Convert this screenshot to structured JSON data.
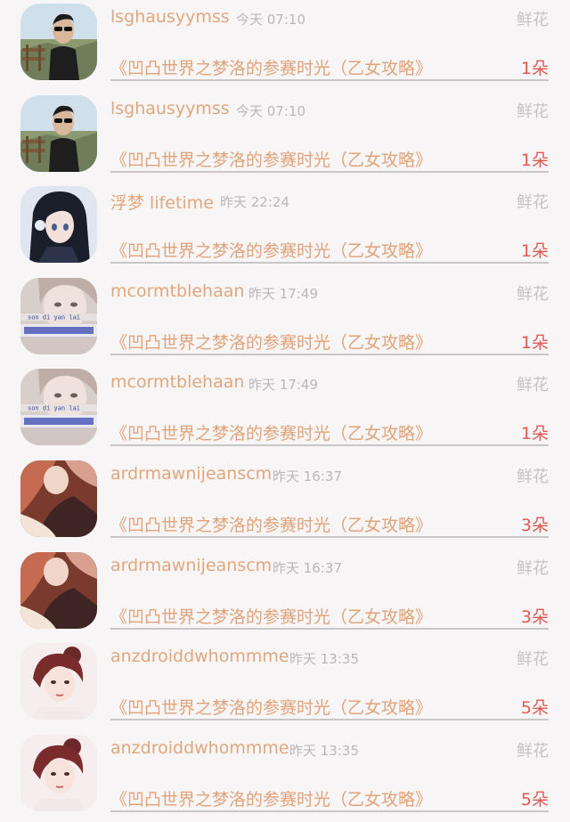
{
  "rows": [
    {
      "username": "lsghausyymss",
      "time": "今天 07:10",
      "gift": "鲜花",
      "title": "《凹凸世界之梦洛的参赛时光（乙女攻略》",
      "count": "1朵",
      "avatar": "man-sunglasses"
    },
    {
      "username": "lsghausyymss",
      "time": "今天 07:10",
      "gift": "鲜花",
      "title": "《凹凸世界之梦洛的参赛时光（乙女攻略》",
      "count": "1朵",
      "avatar": "man-sunglasses"
    },
    {
      "username": "浮梦 lifetime",
      "time": "昨天 22:24",
      "gift": "鲜花",
      "title": "《凹凸世界之梦洛的参赛时光（乙女攻略》",
      "count": "1朵",
      "avatar": "anime-girl"
    },
    {
      "username": "mcormtblehaan",
      "time": "昨天 17:49",
      "gift": "鲜花",
      "title": "《凹凸世界之梦洛的参赛时光（乙女攻略》",
      "count": "1朵",
      "avatar": "girl-caption"
    },
    {
      "username": "mcormtblehaan",
      "time": "昨天 17:49",
      "gift": "鲜花",
      "title": "《凹凸世界之梦洛的参赛时光（乙女攻略》",
      "count": "1朵",
      "avatar": "girl-caption"
    },
    {
      "username": "ardrmawnijeanscm",
      "time": "昨天 16:37",
      "gift": "鲜花",
      "title": "《凹凸世界之梦洛的参赛时光（乙女攻略》",
      "count": "3朵",
      "avatar": "girl-red-hair"
    },
    {
      "username": "ardrmawnijeanscm",
      "time": "昨天 16:37",
      "gift": "鲜花",
      "title": "《凹凸世界之梦洛的参赛时光（乙女攻略》",
      "count": "3朵",
      "avatar": "girl-red-hair"
    },
    {
      "username": "anzdroiddwhommme",
      "time": "昨天 13:35",
      "gift": "鲜花",
      "title": "《凹凸世界之梦洛的参赛时光（乙女攻略》",
      "count": "5朵",
      "avatar": "girl-bun"
    },
    {
      "username": "anzdroiddwhommme",
      "time": "昨天 13:35",
      "gift": "鲜花",
      "title": "《凹凸世界之梦洛的参赛时光（乙女攻略》",
      "count": "5朵",
      "avatar": "girl-bun"
    }
  ],
  "avatar_captions": {
    "girl-caption": "son di yan lai"
  },
  "colors": {
    "username": "#e1a77c",
    "time": "#b9b7b8",
    "gift": "#c4c2c3",
    "title": "#e0a37a",
    "count": "#e05a55",
    "divider": "#c8c6c7",
    "background": "#f7f5f6"
  }
}
